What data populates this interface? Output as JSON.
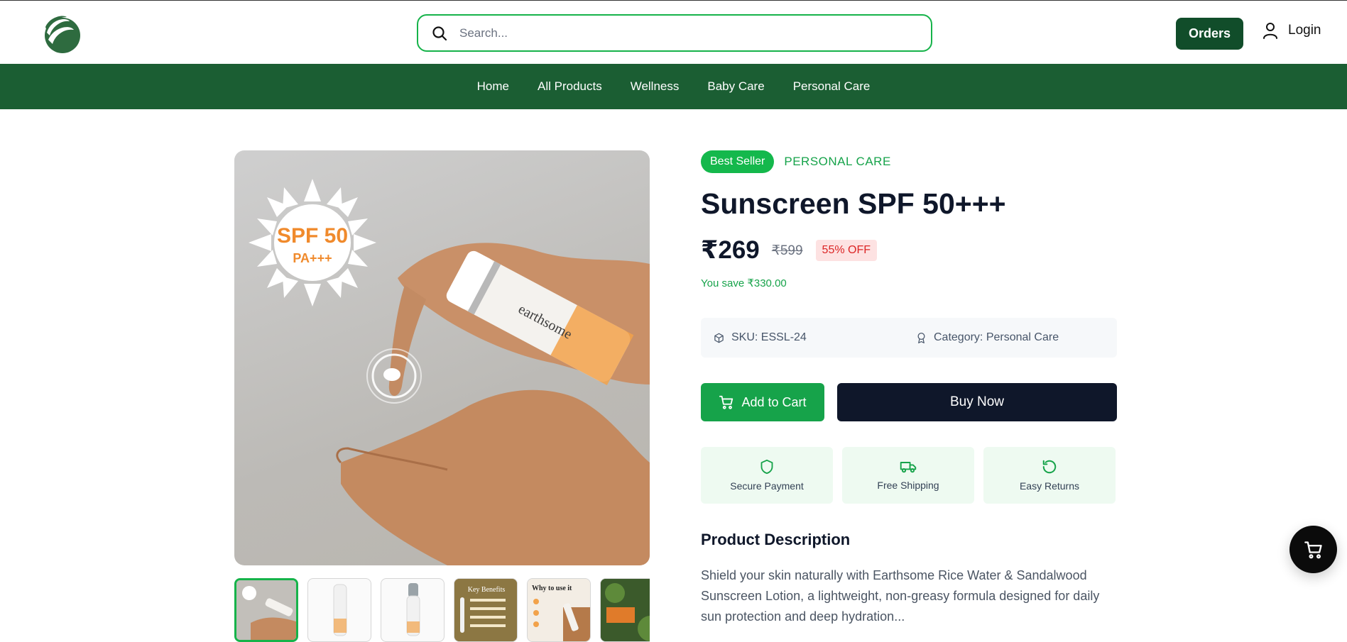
{
  "header": {
    "search_placeholder": "Search...",
    "orders_label": "Orders",
    "login_label": "Login"
  },
  "nav": {
    "items": [
      {
        "label": "Home"
      },
      {
        "label": "All Products"
      },
      {
        "label": "Wellness"
      },
      {
        "label": "Baby Care"
      },
      {
        "label": "Personal Care"
      }
    ]
  },
  "gallery": {
    "main_image_text": {
      "line1": "SPF 50",
      "line2": "PA+++"
    },
    "thumbnail_text": {
      "key_benefits": "Key Benefits",
      "why_to_use": "Why to use it"
    },
    "active_thumbnail_index": 0
  },
  "product": {
    "badge": "Best Seller",
    "category_tag": "PERSONAL CARE",
    "title": "Sunscreen SPF 50+++",
    "price": "₹269",
    "mrp": "₹599",
    "discount": "55% OFF",
    "savings": "You save ₹330.00",
    "sku": "SKU: ESSL-24",
    "category": "Category: Personal Care",
    "add_to_cart": "Add to Cart",
    "buy_now": "Buy Now",
    "features": [
      {
        "label": "Secure Payment",
        "icon": "shield-icon"
      },
      {
        "label": "Free Shipping",
        "icon": "truck-icon"
      },
      {
        "label": "Easy Returns",
        "icon": "refresh-icon"
      }
    ],
    "description_heading": "Product Description",
    "description": "Shield your skin naturally with Earthsome Rice Water & Sandalwood Sunscreen Lotion, a lightweight, non-greasy formula designed for daily sun protection and deep hydration..."
  },
  "colors": {
    "brand_dark": "#1b5e33",
    "accent_green": "#16a34a",
    "dark": "#0f172a",
    "discount_red": "#dc2626"
  }
}
